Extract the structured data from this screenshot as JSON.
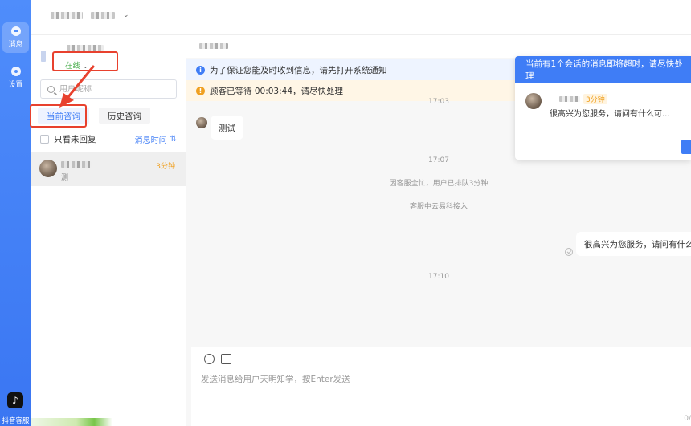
{
  "nav": {
    "messages_label": "消息",
    "settings_label": "设置",
    "tiktok_label": "抖音客服"
  },
  "agent": {
    "status": "在线"
  },
  "search": {
    "placeholder": "用户昵称"
  },
  "tabs": {
    "current": "当前咨询",
    "history": "历史咨询"
  },
  "filter": {
    "unreplied_label": "只看未回复",
    "sort_label": "消息时间"
  },
  "session": {
    "wait_badge": "3分钟",
    "preview": "测"
  },
  "banners": {
    "notify": "为了保证您能及时收到信息，请先打开系统通知",
    "waiting": "顾客已等待 00:03:44，请尽快处理"
  },
  "chat": {
    "time_top": "17:03",
    "customer_msg": "测试",
    "time_1": "17:07",
    "sys_queue": "因客服全忙，用户已排队3分钟",
    "sys_join": "客服中云易科接入",
    "agent_msg": "很高兴为您服务，请问有什么可",
    "time_2": "17:10"
  },
  "composer": {
    "placeholder": "发送消息给用户天明知学，按Enter发送",
    "counter": "0/"
  },
  "popup": {
    "title": "当前有1个会话的消息即将超时，请尽快处理",
    "wait_badge": "3分钟",
    "preview": "很高兴为您服务，请问有什么可..."
  },
  "colors": {
    "accent": "#3f7df6",
    "online": "#4caf50",
    "warn": "#f0a020",
    "annotation": "#e8412e"
  },
  "icons": [
    "chat-icon",
    "gear-icon",
    "tiktok-icon",
    "search-icon",
    "sort-icon",
    "info-icon",
    "warning-icon",
    "emoji-icon",
    "image-icon",
    "read-check-icon",
    "arrow-annotation"
  ]
}
